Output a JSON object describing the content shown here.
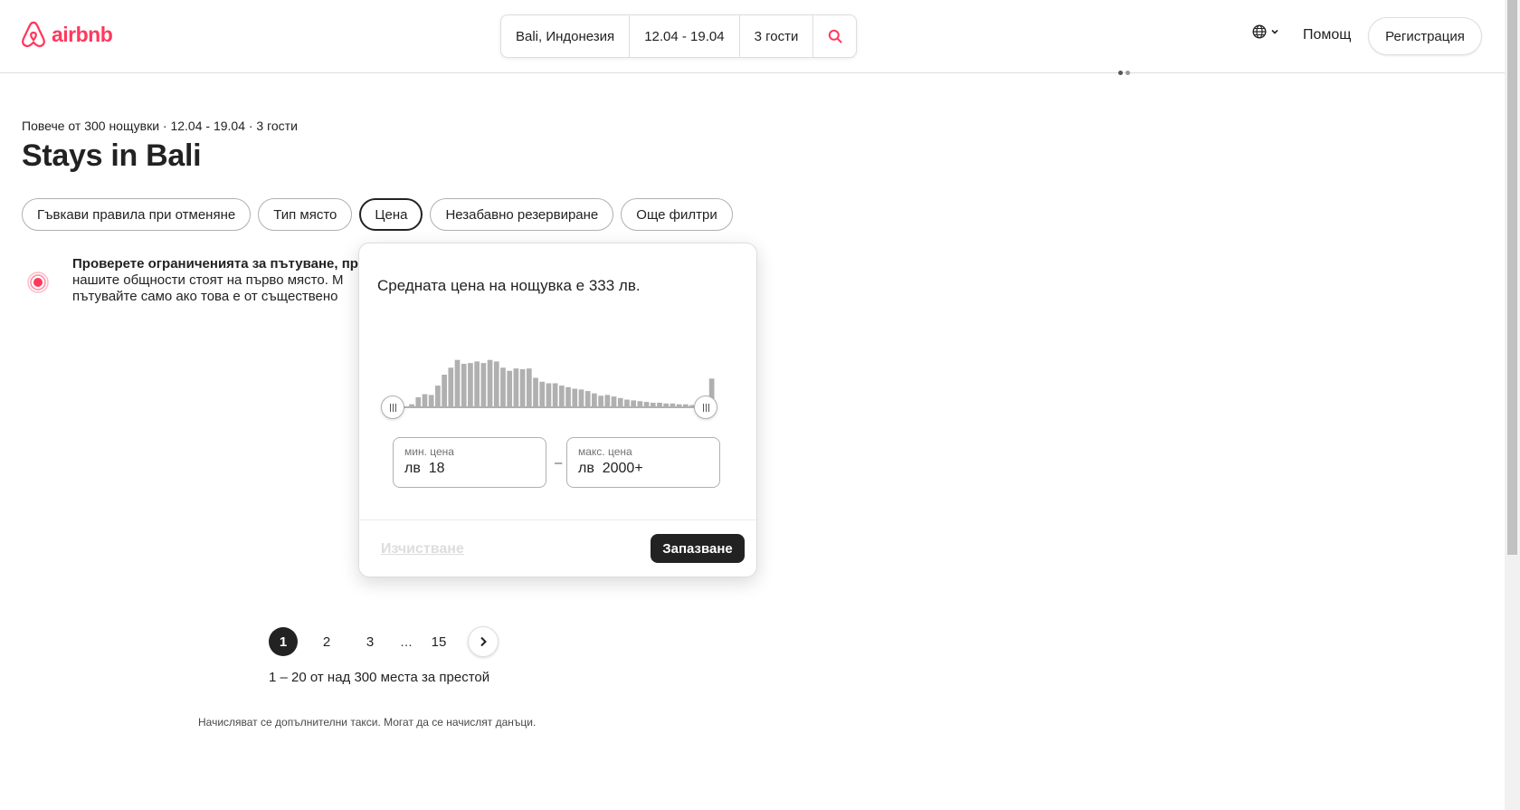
{
  "header": {
    "logo_text": "airbnb",
    "brand_color": "#FF385C",
    "search": {
      "location": "Bali, Индонезия",
      "dates": "12.04 - 19.04",
      "guests": "3 гости"
    },
    "help_label": "Помощ",
    "register_label": "Регистрация"
  },
  "main": {
    "subtitle": "Повече от 300 нощувки · 12.04 - 19.04 · 3 гости",
    "title": "Stays in Bali",
    "filters": [
      "Гъвкави правила при отменяне",
      "Тип място",
      "Цена",
      "Незабавно резервиране",
      "Още филтри"
    ],
    "active_filter": "Цена",
    "notice": {
      "title": "Проверете ограниченията за пътуване, пре",
      "line2": "нашите общности стоят на първо място. М",
      "line3": "пътувайте само ако това е от съществено"
    }
  },
  "price_popover": {
    "average_text": "Средната цена на нощувка е 333 лв.",
    "min_label": "мин. цена",
    "min_currency": "лв",
    "min_value": "18",
    "max_label": "макс. цена",
    "max_currency": "лв",
    "max_value": "2000+",
    "dash": "–",
    "clear_label": "Изчистване",
    "save_label": "Запазване",
    "histogram_relative_heights": [
      0.02,
      0.05,
      0.14,
      0.18,
      0.17,
      0.29,
      0.43,
      0.52,
      0.62,
      0.57,
      0.58,
      0.6,
      0.58,
      0.62,
      0.6,
      0.52,
      0.48,
      0.51,
      0.5,
      0.51,
      0.39,
      0.34,
      0.32,
      0.32,
      0.29,
      0.27,
      0.25,
      0.24,
      0.22,
      0.19,
      0.16,
      0.17,
      0.15,
      0.13,
      0.11,
      0.1,
      0.09,
      0.08,
      0.07,
      0.07,
      0.06,
      0.06,
      0.05,
      0.05,
      0.04,
      0.04,
      0.04,
      0.38
    ]
  },
  "pagination": {
    "pages": [
      "1",
      "2",
      "3"
    ],
    "current": "1",
    "ellipsis": "…",
    "last": "15"
  },
  "results_count": "1 – 20 от над 300 места за престой",
  "fees_note": "Начисляват се допълнителни такси. Могат да се начислят данъци."
}
